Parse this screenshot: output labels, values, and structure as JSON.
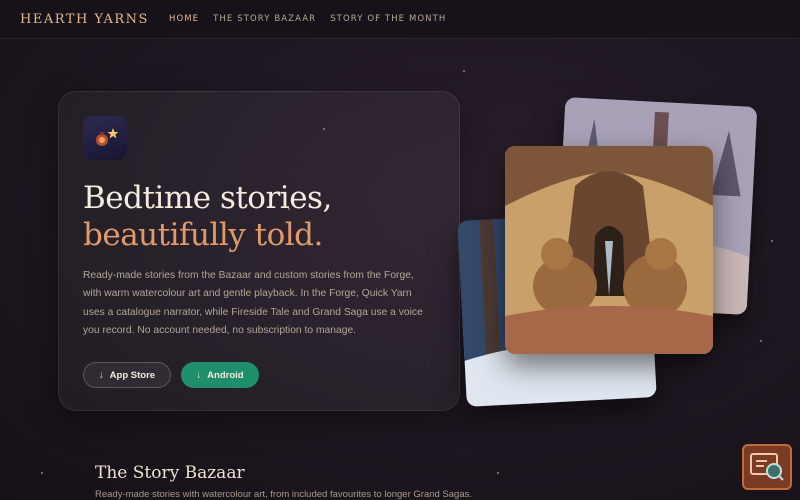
{
  "nav": {
    "logo": "HEARTH YARNS",
    "links": [
      {
        "label": "HOME",
        "active": true
      },
      {
        "label": "THE STORY BAZAAR",
        "active": false
      },
      {
        "label": "STORY OF THE MONTH",
        "active": false
      }
    ]
  },
  "hero": {
    "app_icon": "lantern-star-icon",
    "headline_line1": "Bedtime stories,",
    "headline_line2": "beautifully told.",
    "description": "Ready-made stories from the Bazaar and custom stories from the Forge, with warm watercolour art and gentle playback. In the Forge, Quick Yarn uses a catalogue narrator, while Fireside Tale and Grand Saga use a voice you record. No account needed, no subscription to manage.",
    "buttons": {
      "app_store": {
        "icon": "download-arrow-icon",
        "label": "App Store"
      },
      "android": {
        "icon": "download-arrow-icon",
        "label": "Android"
      }
    }
  },
  "gallery": {
    "cards": [
      "winter-forest-illustration",
      "bears-by-tree-illustration",
      "snowy-night-illustration"
    ]
  },
  "bazaar_section": {
    "title": "The Story Bazaar",
    "subtitle": "Ready-made stories with watercolour art, from included favourites to longer Grand Sagas."
  },
  "floating_button": {
    "icon": "chat-search-icon"
  },
  "colors": {
    "accent": "#e2b98c",
    "headline_accent": "#e09a6c",
    "android_button": "#1e8f6a"
  }
}
